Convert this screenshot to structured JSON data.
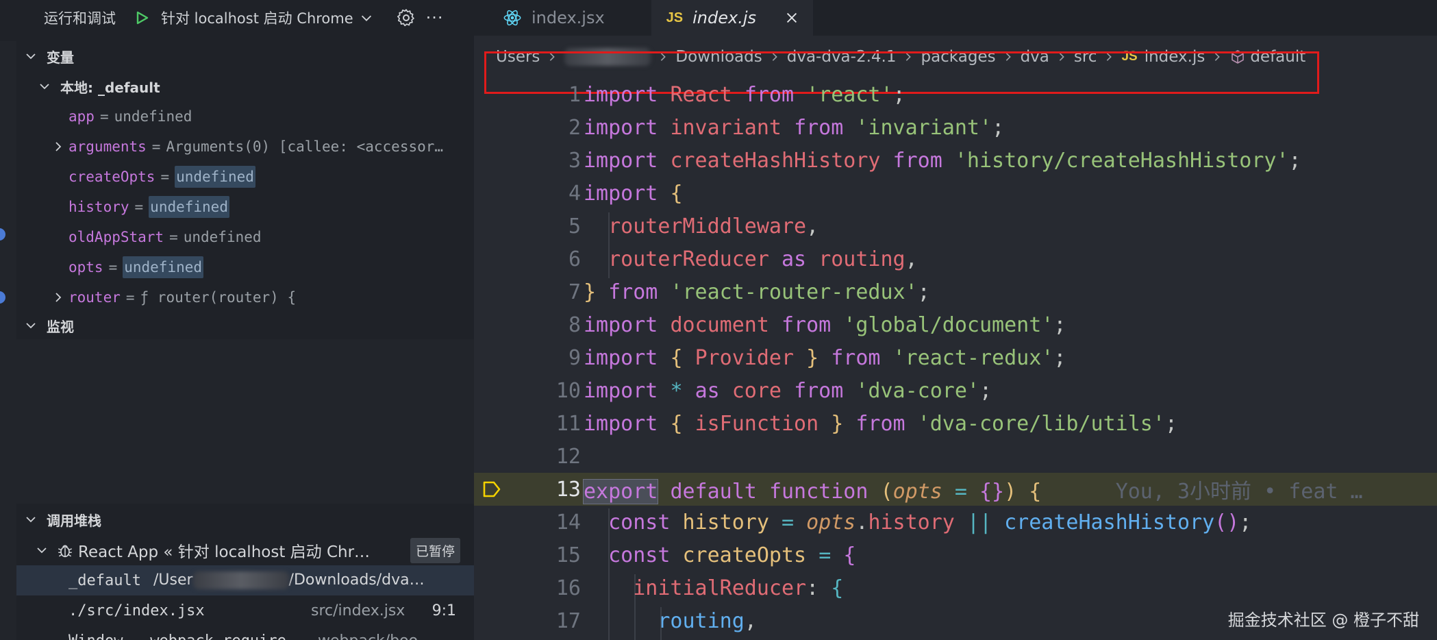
{
  "toolbar": {
    "title": "运行和调试",
    "config": "针对 localhost 启动 Chrome",
    "more": "···"
  },
  "variables": {
    "header": "变量",
    "scope": "本地: _default",
    "items": [
      {
        "name": "app",
        "value": "undefined",
        "highlighted": false,
        "expandable": false
      },
      {
        "name": "arguments",
        "value": "Arguments(0) [callee: <accessor…",
        "highlighted": false,
        "expandable": true
      },
      {
        "name": "createOpts",
        "value": "undefined",
        "highlighted": true,
        "expandable": false
      },
      {
        "name": "history",
        "value": "undefined",
        "highlighted": true,
        "expandable": false
      },
      {
        "name": "oldAppStart",
        "value": "undefined",
        "highlighted": false,
        "expandable": false
      },
      {
        "name": "opts",
        "value": "undefined",
        "highlighted": true,
        "expandable": false
      },
      {
        "name": "router",
        "value": "ƒ router(router) {",
        "highlighted": false,
        "expandable": true
      }
    ]
  },
  "watch": {
    "header": "监视"
  },
  "callstack": {
    "header": "调用堆栈",
    "session": "React App « 针对 localhost 启动 Chr…",
    "status": "已暂停",
    "frames": [
      {
        "name": "_default",
        "path_start": "/User",
        "path_end": "/Downloads/dva…",
        "src": "",
        "pos": ""
      },
      {
        "name": "./src/index.jsx",
        "path_start": "",
        "path_end": "",
        "src": "src/index.jsx",
        "pos": "9:1"
      },
      {
        "name": "Window.__webpack_require__",
        "path_start": "",
        "path_end": "",
        "src": "webpack/boo…",
        "pos": ""
      }
    ]
  },
  "tabs": [
    {
      "label": "index.jsx",
      "icon": "react-icon",
      "active": false
    },
    {
      "label": "index.js",
      "icon": "JS",
      "active": true
    }
  ],
  "breadcrumb": {
    "items": [
      "Users",
      "Downloads",
      "dva-dva-2.4.1",
      "packages",
      "dva",
      "src",
      "index.js",
      "default"
    ],
    "js_label": "JS"
  },
  "code": {
    "current_line": 13,
    "blame": "You, 3小时前 • feat …",
    "lines": [
      1,
      2,
      3,
      4,
      5,
      6,
      7,
      8,
      9,
      10,
      11,
      12,
      13,
      14,
      15,
      16,
      17
    ]
  },
  "watermark": "掘金技术社区 @ 橙子不甜",
  "colors": {
    "keyword": "#c678dd",
    "identifier": "#e06c75",
    "string": "#98c379",
    "function": "#61afef",
    "highlight": "#e01b1b"
  }
}
